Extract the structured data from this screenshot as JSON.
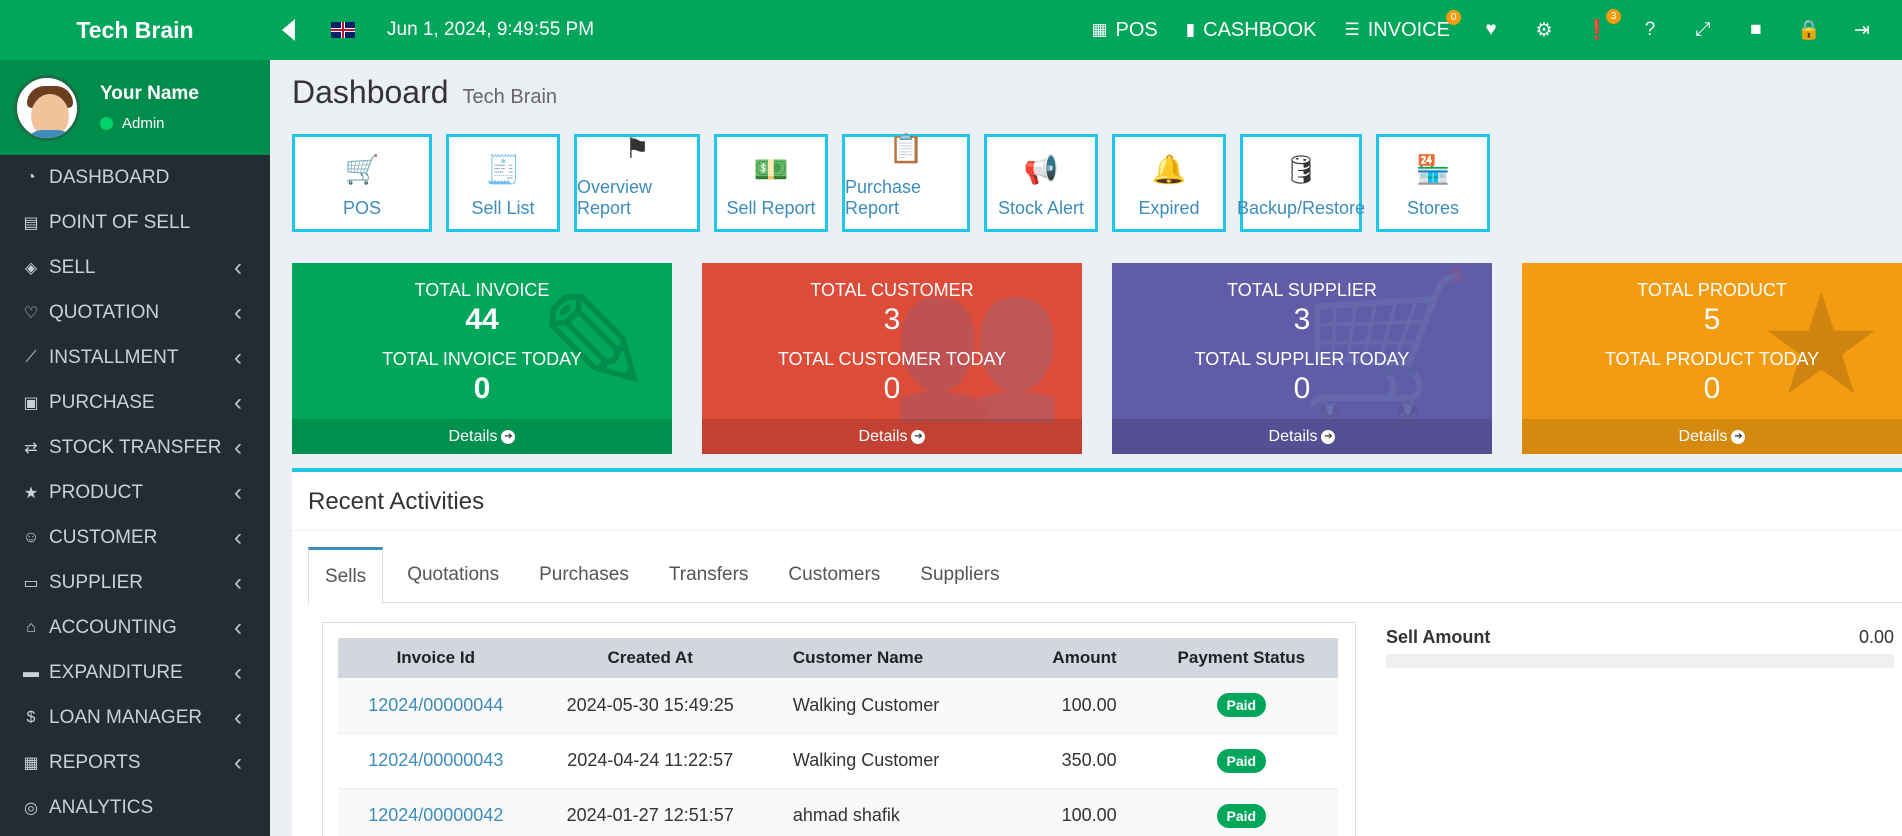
{
  "brand": "Tech Brain",
  "user": {
    "name": "Your Name",
    "role": "Admin"
  },
  "sidebar": {
    "items": [
      {
        "label": "DASHBOARD",
        "icon": "gauge-icon",
        "glyph": "◔",
        "chevron": false
      },
      {
        "label": "POINT OF SELL",
        "icon": "edit-icon",
        "glyph": "▤",
        "chevron": false
      },
      {
        "label": "SELL",
        "icon": "money-icon",
        "glyph": "◈",
        "chevron": true
      },
      {
        "label": "QUOTATION",
        "icon": "heart-icon",
        "glyph": "♡",
        "chevron": true
      },
      {
        "label": "INSTALLMENT",
        "icon": "chart-line-icon",
        "glyph": "⟋",
        "chevron": true
      },
      {
        "label": "PURCHASE",
        "icon": "shopping-bag-icon",
        "glyph": "▣",
        "chevron": true
      },
      {
        "label": "STOCK TRANSFER",
        "icon": "exchange-icon",
        "glyph": "⇄",
        "chevron": true
      },
      {
        "label": "PRODUCT",
        "icon": "star-icon",
        "glyph": "★",
        "chevron": true
      },
      {
        "label": "CUSTOMER",
        "icon": "handshake-icon",
        "glyph": "☺",
        "chevron": true
      },
      {
        "label": "SUPPLIER",
        "icon": "truck-icon",
        "glyph": "▭",
        "chevron": true
      },
      {
        "label": "ACCOUNTING",
        "icon": "bank-icon",
        "glyph": "⌂",
        "chevron": true
      },
      {
        "label": "EXPANDITURE",
        "icon": "minus-icon",
        "glyph": "▬",
        "chevron": true
      },
      {
        "label": "LOAN MANAGER",
        "icon": "money-bag-icon",
        "glyph": "$",
        "chevron": true
      },
      {
        "label": "REPORTS",
        "icon": "file-report-icon",
        "glyph": "▦",
        "chevron": true
      },
      {
        "label": "ANALYTICS",
        "icon": "search-chart-icon",
        "glyph": "◎",
        "chevron": false
      }
    ]
  },
  "header": {
    "datetime": "Jun 1, 2024, 9:49:55 PM",
    "pos_label": "POS",
    "cashbook_label": "CASHBOOK",
    "invoice_label": "INVOICE",
    "invoice_badge": "0",
    "alert_badge": "3"
  },
  "page": {
    "title": "Dashboard",
    "subtitle": "Tech Brain"
  },
  "shortcuts": [
    {
      "label": "POS",
      "icon": "cart-icon",
      "glyph": "🛒",
      "width": 140
    },
    {
      "label": "Sell List",
      "icon": "list-icon",
      "glyph": "🧾",
      "width": 114
    },
    {
      "label": "Overview Report",
      "icon": "flag-icon",
      "glyph": "⚑",
      "width": 126
    },
    {
      "label": "Sell Report",
      "icon": "money-icon",
      "glyph": "💵",
      "width": 114
    },
    {
      "label": "Purchase Report",
      "icon": "clipboard-icon",
      "glyph": "📋",
      "width": 128
    },
    {
      "label": "Stock Alert",
      "icon": "megaphone-icon",
      "glyph": "📢",
      "width": 114
    },
    {
      "label": "Expired",
      "icon": "bell-icon",
      "glyph": "🔔",
      "width": 114
    },
    {
      "label": "Backup/Restore",
      "icon": "database-icon",
      "glyph": "🛢",
      "width": 122
    },
    {
      "label": "Stores",
      "icon": "store-icon",
      "glyph": "🏪",
      "width": 114
    }
  ],
  "stats": {
    "invoice": {
      "label": "TOTAL INVOICE",
      "value": "44",
      "today_label": "TOTAL INVOICE TODAY",
      "today_value": "0",
      "details": "Details"
    },
    "customer": {
      "label": "TOTAL CUSTOMER",
      "value": "3",
      "today_label": "TOTAL CUSTOMER TODAY",
      "today_value": "0",
      "details": "Details"
    },
    "supplier": {
      "label": "TOTAL SUPPLIER",
      "value": "3",
      "today_label": "TOTAL SUPPLIER TODAY",
      "today_value": "0",
      "details": "Details"
    },
    "product": {
      "label": "TOTAL PRODUCT",
      "value": "5",
      "today_label": "TOTAL PRODUCT TODAY",
      "today_value": "0",
      "details": "Details"
    }
  },
  "colors": {
    "green": "#00a65a",
    "red": "#dd4b39",
    "purple": "#605ca8",
    "orange": "#f39c12",
    "cyan": "#1ec6e8"
  },
  "activity": {
    "title": "Recent Activities",
    "tabs": [
      "Sells",
      "Quotations",
      "Purchases",
      "Transfers",
      "Customers",
      "Suppliers"
    ],
    "columns": [
      "Invoice Id",
      "Created At",
      "Customer Name",
      "Amount",
      "Payment Status"
    ],
    "rows": [
      {
        "id": "12024/00000044",
        "created": "2024-05-30 15:49:25",
        "customer": "Walking Customer",
        "amount": "100.00",
        "status": "Paid"
      },
      {
        "id": "12024/00000043",
        "created": "2024-04-24 11:22:57",
        "customer": "Walking Customer",
        "amount": "350.00",
        "status": "Paid"
      },
      {
        "id": "12024/00000042",
        "created": "2024-01-27 12:51:57",
        "customer": "ahmad shafik",
        "amount": "100.00",
        "status": "Paid"
      }
    ],
    "sell_amount_label": "Sell Amount",
    "sell_amount_value": "0.00"
  }
}
